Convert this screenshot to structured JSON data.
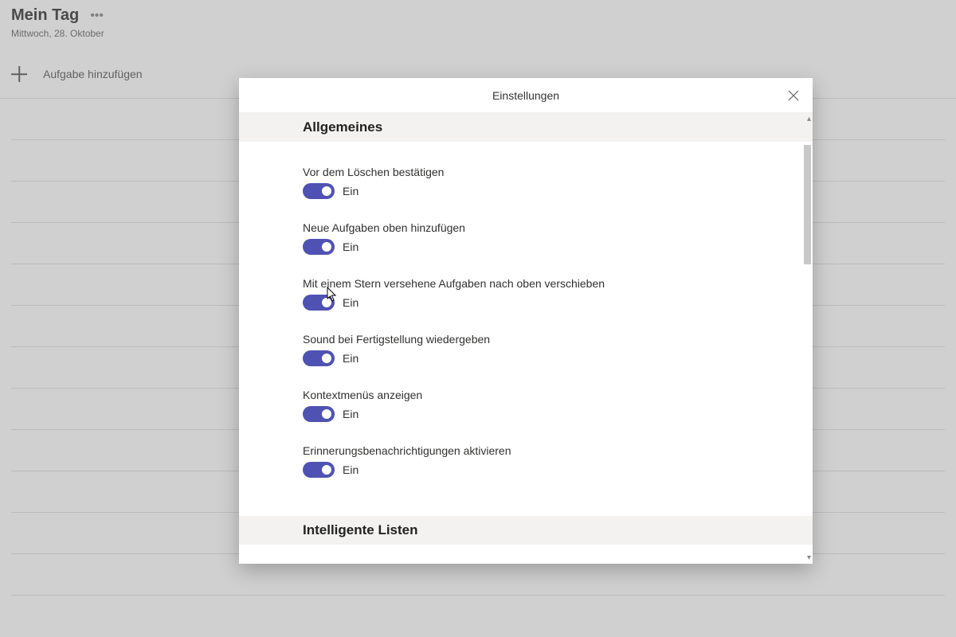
{
  "header": {
    "title": "Mein Tag",
    "date": "Mittwoch, 28. Oktober"
  },
  "add_task": {
    "label": "Aufgabe hinzufügen"
  },
  "modal": {
    "title": "Einstellungen",
    "sections": {
      "general": {
        "header": "Allgemeines",
        "settings": [
          {
            "label": "Vor dem Löschen bestätigen",
            "state": "Ein"
          },
          {
            "label": "Neue Aufgaben oben hinzufügen",
            "state": "Ein"
          },
          {
            "label": "Mit einem Stern versehene Aufgaben nach oben verschieben",
            "state": "Ein"
          },
          {
            "label": "Sound bei Fertigstellung wiedergeben",
            "state": "Ein"
          },
          {
            "label": "Kontextmenüs anzeigen",
            "state": "Ein"
          },
          {
            "label": "Erinnerungsbenachrichtigungen aktivieren",
            "state": "Ein"
          }
        ]
      },
      "smart_lists": {
        "header": "Intelligente Listen"
      }
    }
  },
  "colors": {
    "accent": "#4f52b2"
  }
}
